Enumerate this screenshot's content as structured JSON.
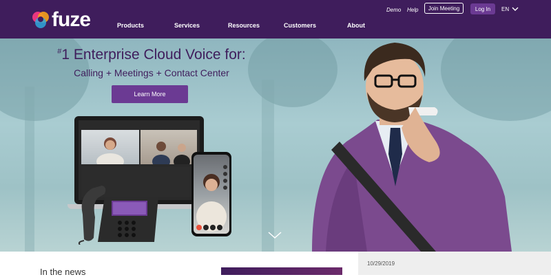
{
  "brand": {
    "name": "fuze"
  },
  "header": {
    "utility": {
      "demo": "Demo",
      "help": "Help",
      "join_meeting": "Join Meeting",
      "login": "Log In",
      "language": "EN"
    },
    "nav": [
      "Products",
      "Services",
      "Resources",
      "Customers",
      "About"
    ]
  },
  "hero": {
    "title_sup": "#",
    "title": "1 Enterprise Cloud Voice for:",
    "subtitle": "Calling + Meetings + Contact Center",
    "cta": "Learn More"
  },
  "news": {
    "label": "In the news",
    "date": "10/29/2019"
  },
  "colors": {
    "header_bg": "#3f1d5c",
    "accent": "#6b3a93"
  },
  "icons": [
    "fuze-logo-icon",
    "chevron-down-icon",
    "scroll-down-chevron-icon"
  ]
}
